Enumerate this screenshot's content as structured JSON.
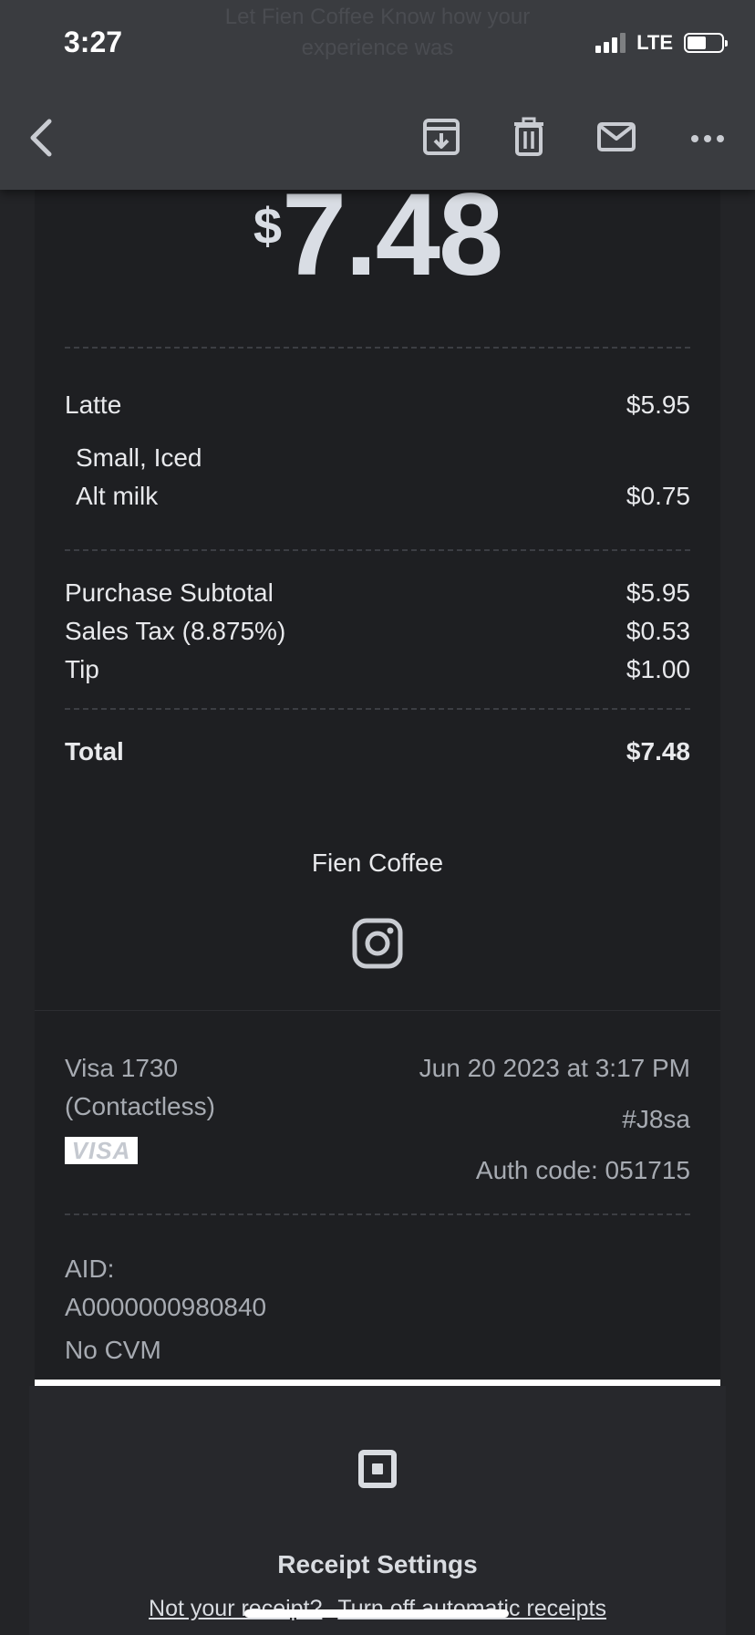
{
  "status_bar": {
    "time": "3:27",
    "network": "LTE"
  },
  "header": {
    "ghost_subject_line1": "Let Fien Coffee Know how your",
    "ghost_subject_line2": "experience was",
    "icons": [
      "back-icon",
      "archive-icon",
      "trash-icon",
      "mail-icon",
      "more-icon"
    ]
  },
  "receipt": {
    "amount_currency": "$",
    "amount_value": "7.48",
    "items": [
      {
        "label": "Latte",
        "price": "$5.95"
      },
      {
        "label": "Small, Iced",
        "price": ""
      },
      {
        "label": "Alt milk",
        "price": "$0.75"
      }
    ],
    "totals": {
      "subtotal_label": "Purchase Subtotal",
      "subtotal_value": "$5.95",
      "tax_label": "Sales Tax (8.875%)",
      "tax_value": "$0.53",
      "tip_label": "Tip",
      "tip_value": "$1.00",
      "total_label": "Total",
      "total_value": "$7.48"
    },
    "store_name": "Fien Coffee",
    "payment": {
      "card": "Visa 1730",
      "method": "(Contactless)",
      "card_logo": "VISA",
      "datetime": "Jun 20 2023 at 3:17 PM",
      "receipt_id": "#J8sa",
      "auth_code": "Auth code: 051715",
      "aid_label": "AID:",
      "aid_value": "A0000000980840",
      "cvm": "No CVM"
    }
  },
  "footer": {
    "settings_title": "Receipt Settings",
    "link_not_yours": "Not your receipt?",
    "link_turn_off": "Turn off automatic receipts"
  },
  "colors": {
    "topbar": "#3a3c40",
    "receipt_bg": "#1e1f22",
    "page_bg": "#232427",
    "muted_text": "#a7abb2"
  }
}
